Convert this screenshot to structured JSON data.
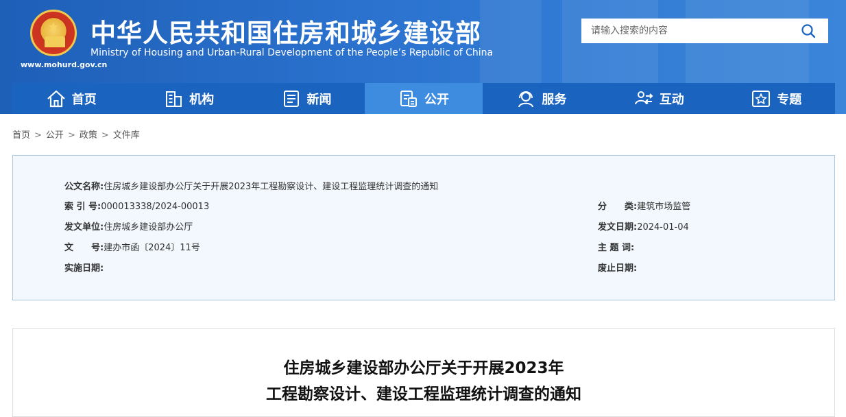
{
  "header": {
    "title_cn": "中华人民共和国住房和城乡建设部",
    "title_en": "Ministry of Housing and Urban-Rural Development of the People’s Republic of China",
    "site_url": "www.mohurd.gov.cn",
    "search_placeholder": "请输入搜索的内容",
    "emblem_icon": "national-emblem-icon",
    "search_icon": "search-icon"
  },
  "nav": {
    "items": [
      {
        "label": "首页",
        "icon": "home-icon",
        "active": false
      },
      {
        "label": "机构",
        "icon": "building-icon",
        "active": false
      },
      {
        "label": "新闻",
        "icon": "news-icon",
        "active": false
      },
      {
        "label": "公开",
        "icon": "document-icon",
        "active": true
      },
      {
        "label": "服务",
        "icon": "service-icon",
        "active": false
      },
      {
        "label": "互动",
        "icon": "interact-icon",
        "active": false
      },
      {
        "label": "专题",
        "icon": "star-topic-icon",
        "active": false
      }
    ]
  },
  "breadcrumb": [
    "首页",
    "公开",
    "政策",
    "文件库"
  ],
  "meta": {
    "doc_name_label": "公文名称:",
    "doc_name": "住房城乡建设部办公厅关于开展2023年工程勘察设计、建设工程监理统计调查的通知",
    "index_label": "索 引 号:",
    "index": "000013338/2024-00013",
    "category_label": "分　　类:",
    "category": "建筑市场监管",
    "issuer_label": "发文单位:",
    "issuer": "住房城乡建设部办公厅",
    "date_label": "发文日期:",
    "date": "2024-01-04",
    "docno_label": "文　　号:",
    "docno": "建办市函〔2024〕11号",
    "keywords_label": "主 题 词:",
    "keywords": "",
    "effective_label": "实施日期:",
    "effective": "",
    "expire_label": "废止日期:",
    "expire": ""
  },
  "article": {
    "title_line1": "住房城乡建设部办公厅关于开展2023年",
    "title_line2": "工程勘察设计、建设工程监理统计调查的通知"
  },
  "colors": {
    "header_blue": "#1e5fb8",
    "nav_blue": "#1a64c0",
    "nav_active": "#3d8ce0",
    "meta_bg": "#f2f8fd",
    "meta_border": "#a9c6dd"
  }
}
